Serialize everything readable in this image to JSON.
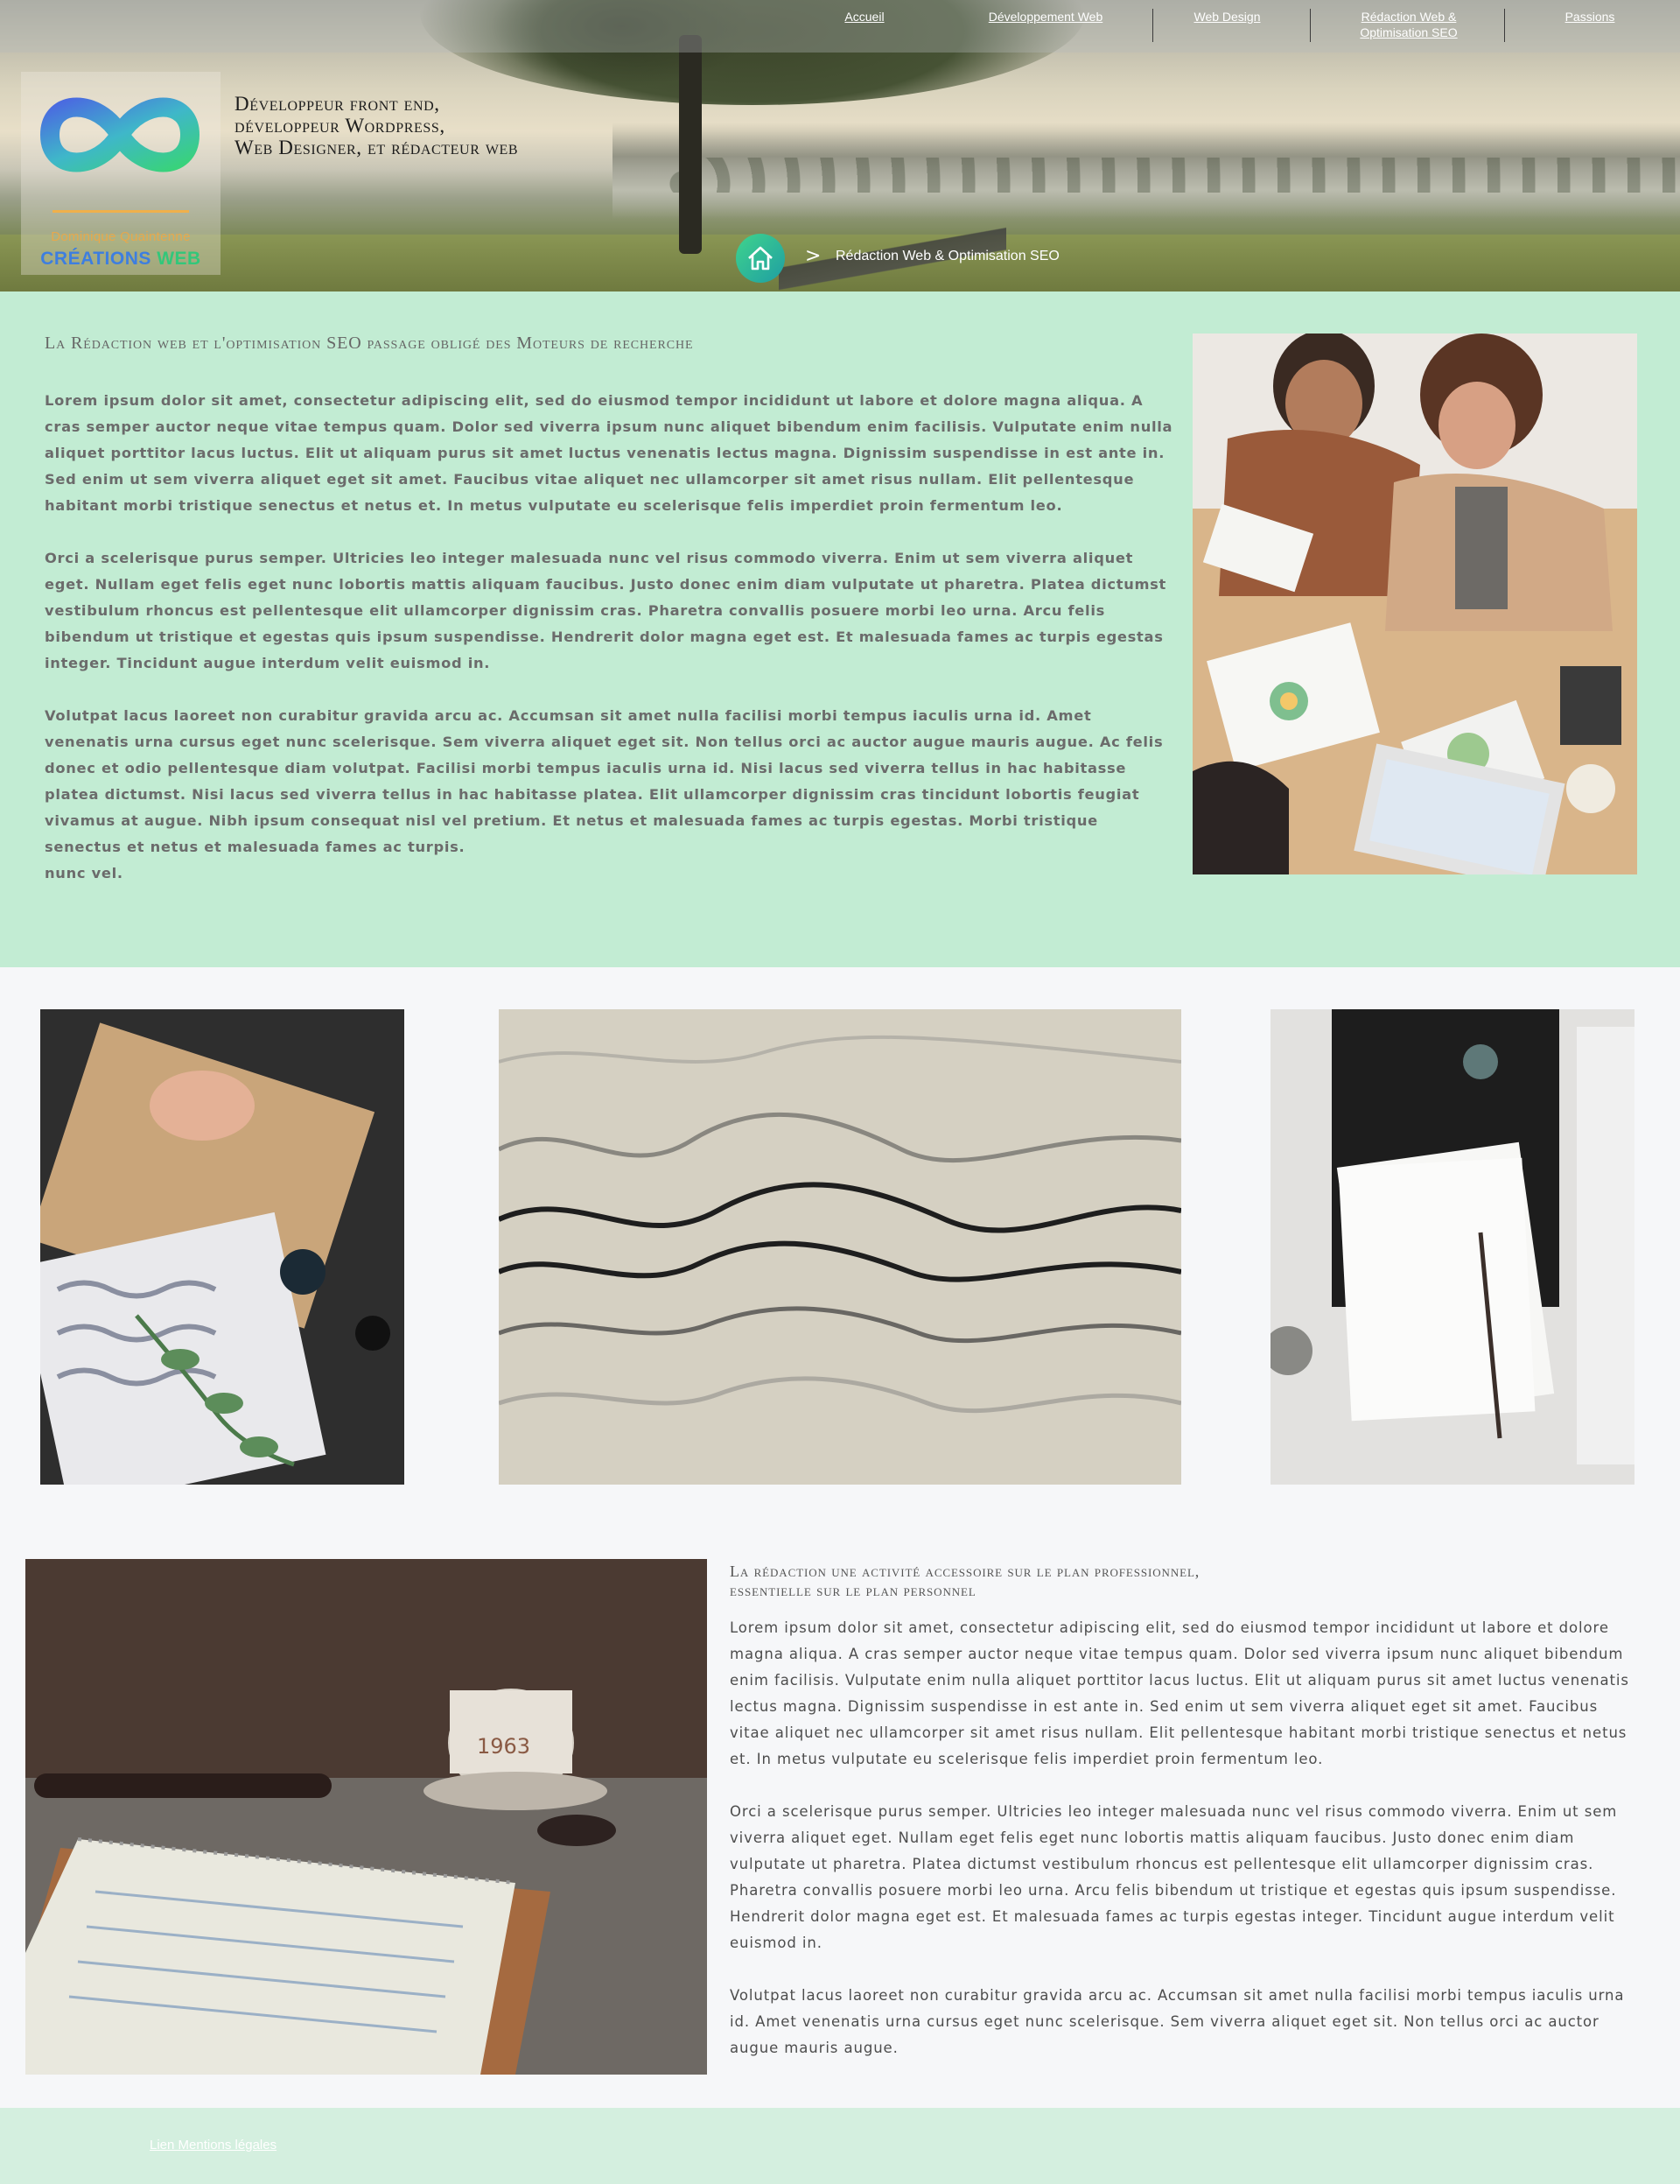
{
  "nav": {
    "items": [
      {
        "label": "Accueil"
      },
      {
        "label": "Développement Web"
      },
      {
        "label": "Web Design"
      },
      {
        "label": "Rédaction Web  &",
        "label2": "Optimisation SEO"
      },
      {
        "label": "Passions"
      }
    ]
  },
  "logo": {
    "name": "Dominique Quaintenne",
    "brand_part1": "CRÉATIONS",
    "brand_part2": "WEB"
  },
  "tagline": {
    "line1": "Développeur front end,",
    "line2": "développeur Wordpress,",
    "line3": "Web Designer, et rédacteur web"
  },
  "breadcrumb": {
    "separator": ">",
    "current": "Rédaction Web & Optimisation SEO"
  },
  "section1": {
    "heading": "La Rédaction web et l'optimisation SEO passage obligé des Moteurs de recherche",
    "paragraphs": [
      "Lorem ipsum dolor sit amet, consectetur adipiscing elit, sed do eiusmod tempor incididunt ut labore et dolore magna aliqua. A cras semper auctor neque vitae tempus quam. Dolor sed viverra ipsum nunc aliquet bibendum enim facilisis. Vulputate enim nulla aliquet porttitor lacus luctus. Elit ut aliquam purus sit amet luctus venenatis lectus magna. Dignissim suspendisse in est ante in. Sed enim ut sem viverra aliquet eget sit amet. Faucibus vitae aliquet nec ullamcorper sit amet risus nullam. Elit pellentesque habitant morbi tristique senectus et netus et. In metus vulputate eu scelerisque felis imperdiet proin fermentum leo.",
      "Orci a scelerisque purus semper. Ultricies leo integer malesuada nunc vel risus commodo viverra. Enim ut sem viverra aliquet eget. Nullam eget felis eget nunc lobortis mattis aliquam faucibus. Justo donec enim diam vulputate ut pharetra. Platea dictumst vestibulum rhoncus est pellentesque elit ullamcorper dignissim cras. Pharetra convallis posuere morbi leo urna. Arcu felis bibendum ut tristique et egestas quis ipsum suspendisse. Hendrerit dolor magna eget est. Et malesuada fames ac turpis egestas integer. Tincidunt augue interdum velit euismod in.",
      "Volutpat lacus laoreet non curabitur gravida arcu ac. Accumsan sit amet nulla facilisi morbi tempus iaculis urna id. Amet venenatis urna cursus eget nunc scelerisque. Sem viverra aliquet eget sit. Non tellus orci ac auctor augue mauris augue. Ac felis donec et odio pellentesque diam volutpat. Facilisi morbi tempus iaculis urna id. Nisi lacus sed viverra tellus in hac habitasse platea dictumst. Nisi lacus sed viverra tellus in hac habitasse platea. Elit ullamcorper dignissim cras tincidunt lobortis feugiat vivamus at augue. Nibh ipsum consequat nisl vel pretium. Et netus et malesuada fames ac turpis egestas. Morbi tristique senectus et netus et malesuada fames ac turpis.",
      "nunc vel."
    ]
  },
  "section2": {
    "heading_line1": "La rédaction une activité accessoire sur le plan professionnel,",
    "heading_line2": "essentielle sur le plan personnel",
    "paragraphs": [
      "Lorem ipsum dolor sit amet, consectetur adipiscing elit, sed do eiusmod tempor incididunt ut labore et dolore magna aliqua. A cras semper auctor neque vitae tempus quam. Dolor sed viverra ipsum nunc aliquet bibendum enim facilisis. Vulputate enim nulla aliquet porttitor lacus luctus. Elit ut aliquam purus sit amet luctus venenatis lectus magna. Dignissim suspendisse in est ante in. Sed enim ut sem viverra aliquet eget sit amet. Faucibus vitae aliquet nec ullamcorper sit amet risus nullam. Elit pellentesque habitant morbi tristique senectus et netus et. In metus vulputate eu scelerisque felis imperdiet proin fermentum leo.",
      "Orci a scelerisque purus semper. Ultricies leo integer malesuada nunc vel risus commodo viverra. Enim ut sem viverra aliquet eget. Nullam eget felis eget nunc lobortis mattis aliquam faucibus. Justo donec enim diam vulputate ut pharetra. Platea dictumst vestibulum rhoncus est pellentesque elit ullamcorper dignissim cras. Pharetra convallis posuere morbi leo urna. Arcu felis bibendum ut tristique et egestas quis ipsum suspendisse. Hendrerit dolor magna eget est. Et malesuada fames ac turpis egestas integer. Tincidunt augue interdum velit euismod in.",
      "Volutpat lacus laoreet non curabitur gravida arcu ac. Accumsan sit amet nulla facilisi morbi tempus iaculis urna id. Amet venenatis urna cursus eget nunc scelerisque. Sem viverra aliquet eget sit. Non tellus orci ac auctor augue mauris augue."
    ]
  },
  "images": {
    "team_alt": "team-meeting-photo",
    "mug_text": "1963"
  },
  "footer": {
    "legal_link": "Lien Mentions légales"
  },
  "colors": {
    "section1_bg": "#c2ecd3",
    "page_bg": "#f6f7f9",
    "footer_bg": "#d4efdf",
    "logo_accent": "#f0b04b",
    "brand_blue": "#3d7ee0",
    "brand_green": "#32c77a"
  }
}
